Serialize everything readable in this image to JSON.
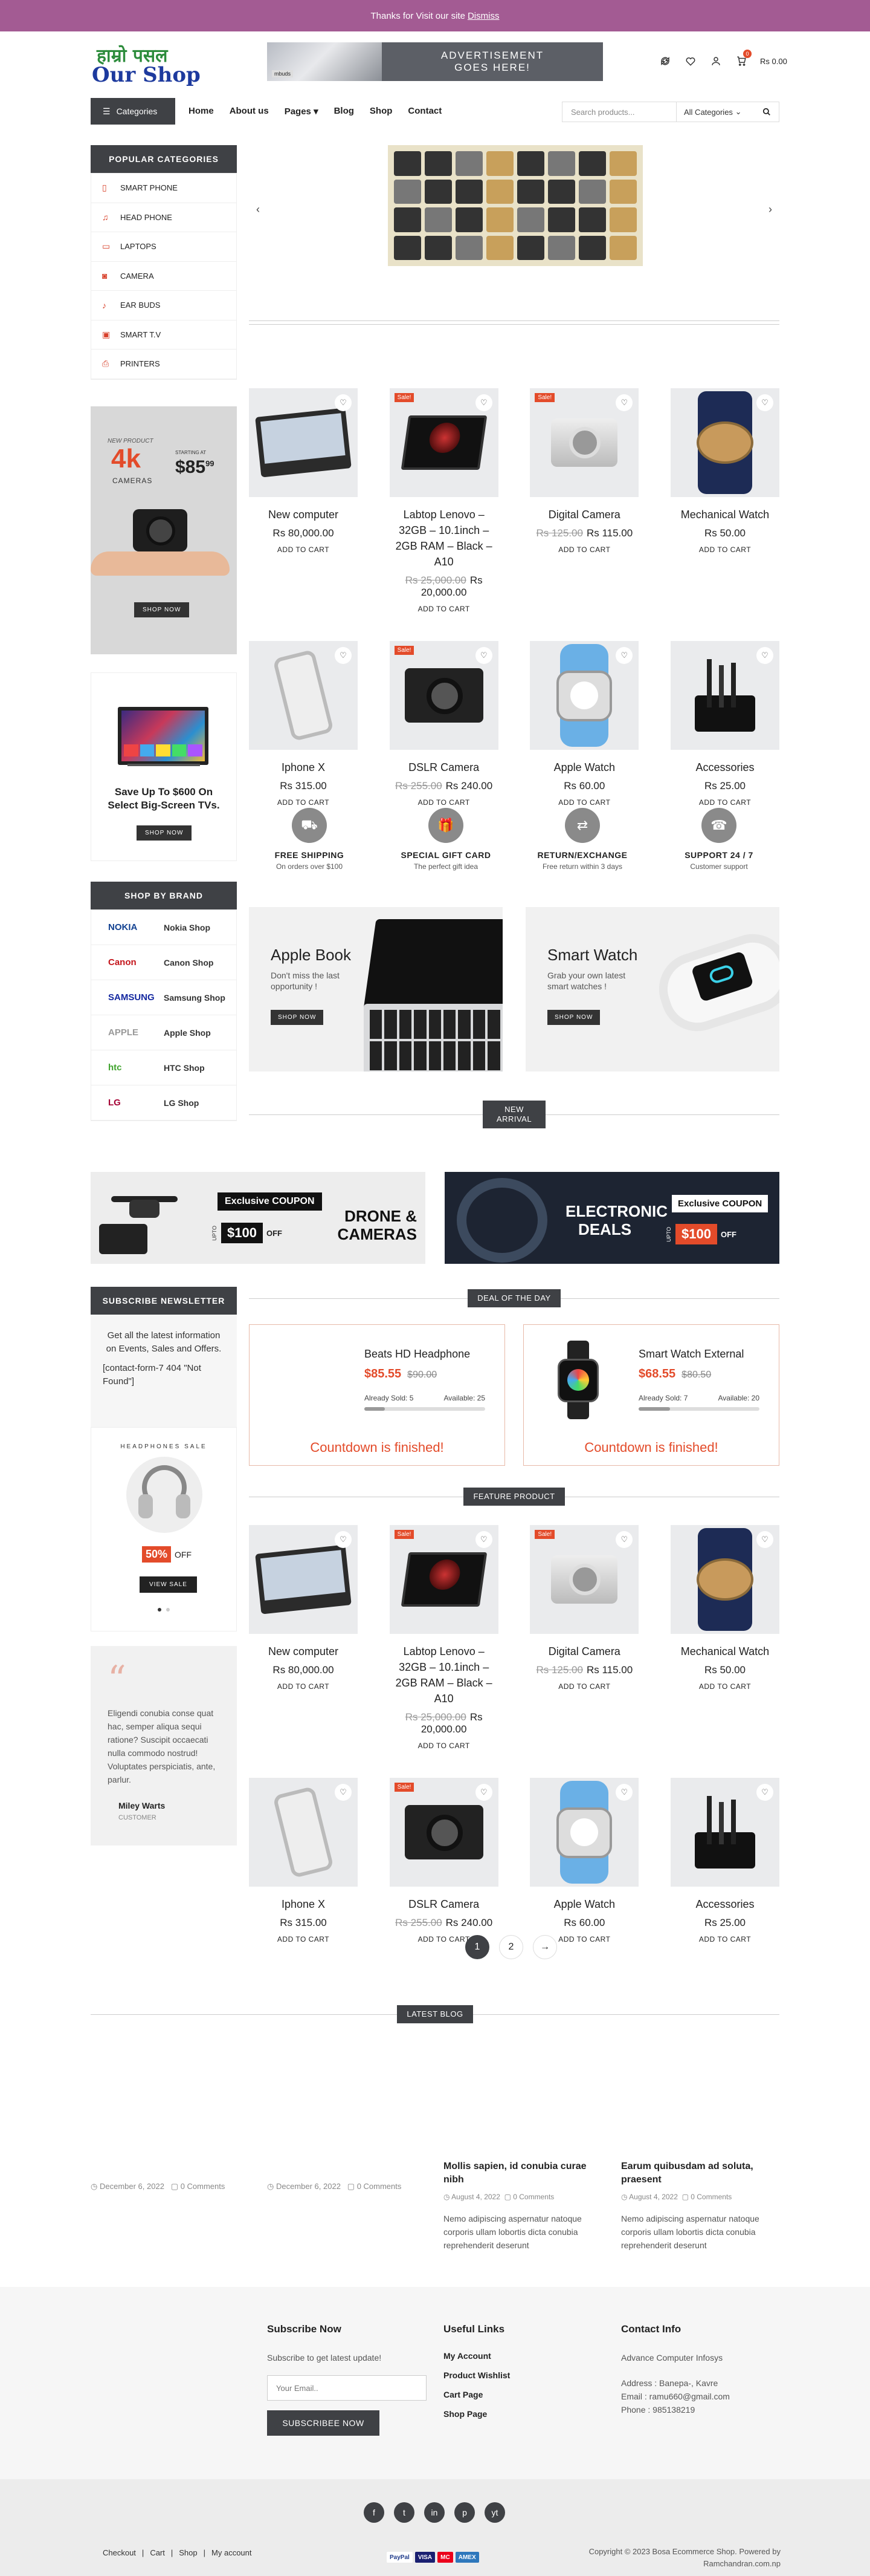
{
  "topbar": {
    "text": "Thanks for Visit our site",
    "link": "Dismiss"
  },
  "logo": {
    "line1": "हाम्रो पसल",
    "line2": "Our Shop"
  },
  "ad": {
    "line1": "ADVERTISEMENT",
    "line2": "GOES HERE!",
    "tag": "mbuds"
  },
  "header": {
    "cart_count": "0",
    "cart_amount": "Rs 0.00"
  },
  "nav": {
    "categories": "Categories",
    "menu": [
      "Home",
      "About us",
      "Pages",
      "Blog",
      "Shop",
      "Contact"
    ],
    "search_placeholder": "Search products...",
    "category_select": "All Categories"
  },
  "popular": {
    "title": "POPULAR CATEGORIES",
    "items": [
      "SMART PHONE",
      "HEAD PHONE",
      "LAPTOPS",
      "CAMERA",
      "EAR BUDS",
      "SMART T.V",
      "PRINTERS"
    ]
  },
  "promo": {
    "kicker": "NEW PRODUCT",
    "big": "4k",
    "sub": "CAMERAS",
    "starting": "STARTING AT",
    "price": "$85",
    "cents": "99",
    "button": "SHOP NOW"
  },
  "tv": {
    "text": "Save Up To $600 On Select Big-Screen TVs.",
    "button": "SHOP NOW"
  },
  "brands": {
    "title": "SHOP BY BRAND",
    "items": [
      {
        "logo": "NOKIA",
        "label": "Nokia Shop",
        "color": "#124191"
      },
      {
        "logo": "Canon",
        "label": "Canon Shop",
        "color": "#c4161c"
      },
      {
        "logo": "SAMSUNG",
        "label": "Samsung Shop",
        "color": "#1428a0"
      },
      {
        "logo": "APPLE",
        "label": "Apple Shop",
        "color": "#999999"
      },
      {
        "logo": "htc",
        "label": "HTC Shop",
        "color": "#3fa32c"
      },
      {
        "logo": "LG",
        "label": "LG Shop",
        "color": "#a50034"
      }
    ]
  },
  "products": [
    {
      "name": "New computer",
      "old": "",
      "price": "Rs 80,000.00",
      "sale": false,
      "cart": "ADD TO CART"
    },
    {
      "name": "Labtop Lenovo – 32GB – 10.1inch – 2GB RAM – Black – A10",
      "old": "Rs 25,000.00",
      "price": "Rs 20,000.00",
      "sale": true,
      "cart": "ADD TO CART"
    },
    {
      "name": "Digital Camera",
      "old": "Rs 125.00",
      "price": "Rs 115.00",
      "sale": true,
      "cart": "ADD TO CART"
    },
    {
      "name": "Mechanical Watch",
      "old": "",
      "price": "Rs 50.00",
      "sale": false,
      "cart": "ADD TO CART"
    },
    {
      "name": "Iphone X",
      "old": "",
      "price": "Rs 315.00",
      "sale": false,
      "cart": "ADD TO CART"
    },
    {
      "name": "DSLR Camera",
      "old": "Rs 255.00",
      "price": "Rs 240.00",
      "sale": true,
      "cart": "ADD TO CART"
    },
    {
      "name": "Apple Watch",
      "old": "",
      "price": "Rs 60.00",
      "sale": false,
      "cart": "ADD TO CART"
    },
    {
      "name": "Accessories",
      "old": "",
      "price": "Rs 25.00",
      "sale": false,
      "cart": "ADD TO CART"
    }
  ],
  "sale_label": "Sale!",
  "features": [
    {
      "title": "FREE SHIPPING",
      "sub": "On orders over $100",
      "icon": "truck-icon"
    },
    {
      "title": "SPECIAL GIFT CARD",
      "sub": "The perfect gift idea",
      "icon": "gift-icon"
    },
    {
      "title": "RETURN/EXCHANGE",
      "sub": "Free return within 3 days",
      "icon": "return-icon"
    },
    {
      "title": "SUPPORT 24 / 7",
      "sub": "Customer support",
      "icon": "phone-icon"
    }
  ],
  "banners": [
    {
      "title": "Apple Book",
      "sub": "Don't miss the last opportunity !",
      "button": "SHOP NOW"
    },
    {
      "title": "Smart Watch",
      "sub": "Grab your own latest smart watches !",
      "button": "SHOP NOW"
    }
  ],
  "new_arrival": "NEW ARRIVAL",
  "coupons": [
    {
      "tag": "Exclusive COUPON",
      "title": "DRONE & CAMERAS",
      "upto": "UPTO",
      "amount": "$100",
      "off": "OFF"
    },
    {
      "tag": "Exclusive COUPON",
      "title": "ELECTRONIC DEALS",
      "upto": "UPTO",
      "amount": "$100",
      "off": "OFF"
    }
  ],
  "deal_title": "DEAL OF THE DAY",
  "deals": [
    {
      "name": "Beats HD Headphone",
      "price": "$85.55",
      "old": "$90.00",
      "sold": "Already Sold: 5",
      "avail": "Available: 25",
      "sold_fraction": 0.17,
      "countdown": "Countdown is finished!"
    },
    {
      "name": "Smart Watch External",
      "price": "$68.55",
      "old": "$80.50",
      "sold": "Already Sold: 7",
      "avail": "Available: 20",
      "sold_fraction": 0.26,
      "countdown": "Countdown is finished!"
    }
  ],
  "subscribe": {
    "title": "SUBSCRIBE NEWSLETTER",
    "text": "Get all the latest information on Events, Sales and Offers.",
    "form": "[contact-form-7 404 \"Not Found\"]"
  },
  "hsale": {
    "label": "HEADPHONES SALE",
    "pct": "50%",
    "off": "OFF",
    "button": "VIEW SALE"
  },
  "feature_title": "FEATURE PRODUCT",
  "pagination": [
    "1",
    "2",
    "→"
  ],
  "testimonial": {
    "text": "Eligendi conubia conse quat hac, semper aliqua sequi ratione? Suscipit occaecati nulla commodo nostrud! Voluptates perspiciatis, ante, parlur.",
    "name": "Miley Warts",
    "role": "CUSTOMER"
  },
  "latest_blog": "LATEST BLOG",
  "blog": [
    {
      "date": "December 6, 2022",
      "comments": "0 Comments"
    },
    {
      "date": "December 6, 2022",
      "comments": "0 Comments"
    },
    {
      "title": "Mollis sapien, id conubia curae nibh",
      "date": "August 4, 2022",
      "comments": "0 Comments",
      "text": "Nemo adipiscing aspernatur natoque corporis ullam lobortis dicta conubia reprehenderit deserunt"
    },
    {
      "title": "Earum quibusdam ad soluta, praesent",
      "date": "August 4, 2022",
      "comments": "0 Comments",
      "text": "Nemo adipiscing aspernatur natoque corporis ullam lobortis dicta conubia reprehenderit deserunt"
    }
  ],
  "footer": {
    "subscribe_title": "Subscribe Now",
    "subscribe_text": "Subscribe to get latest update!",
    "email_placeholder": "Your Email..",
    "subscribe_button": "SUBSCRIBEE NOW",
    "links_title": "Useful Links",
    "links": [
      "My Account",
      "Product Wishlist",
      "Cart Page",
      "Shop Page"
    ],
    "contact_title": "Contact Info",
    "company": "Advance Computer Infosys",
    "address": "Address : Banepa-, Kavre",
    "email": "Email : ramu660@gmail.com",
    "phone": "Phone : 985138219"
  },
  "bottom": {
    "links": [
      "Checkout",
      "Cart",
      "Shop",
      "My account"
    ],
    "copyright": "Copyright © 2023 Bosa Ecommerce Shop. Powered by",
    "credit": "Ramchandran.com.np",
    "social": [
      "f",
      "t",
      "in",
      "p",
      "yt"
    ]
  }
}
